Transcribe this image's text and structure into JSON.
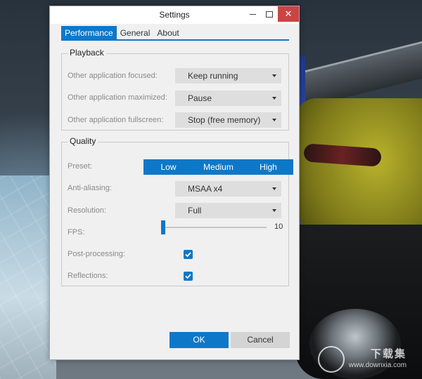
{
  "window": {
    "title": "Settings",
    "close_glyph": "✕"
  },
  "tabs": [
    {
      "label": "Performance",
      "active": true
    },
    {
      "label": "General",
      "active": false
    },
    {
      "label": "About",
      "active": false
    }
  ],
  "playback": {
    "legend": "Playback",
    "rows": [
      {
        "label": "Other application focused:",
        "value": "Keep running"
      },
      {
        "label": "Other application maximized:",
        "value": "Pause"
      },
      {
        "label": "Other application fullscreen:",
        "value": "Stop (free memory)"
      }
    ]
  },
  "quality": {
    "legend": "Quality",
    "preset": {
      "label": "Preset:",
      "options": [
        "Low",
        "Medium",
        "High"
      ]
    },
    "antialiasing": {
      "label": "Anti-aliasing:",
      "value": "MSAA x4"
    },
    "resolution": {
      "label": "Resolution:",
      "value": "Full"
    },
    "fps": {
      "label": "FPS:",
      "value": "10"
    },
    "postprocessing": {
      "label": "Post-processing:",
      "checked": true
    },
    "reflections": {
      "label": "Reflections:",
      "checked": true
    }
  },
  "buttons": {
    "ok": "OK",
    "cancel": "Cancel"
  },
  "watermark": {
    "main": "下载集",
    "url": "www.downxia.com"
  },
  "colors": {
    "accent": "#0e78c8",
    "close": "#c94545"
  }
}
